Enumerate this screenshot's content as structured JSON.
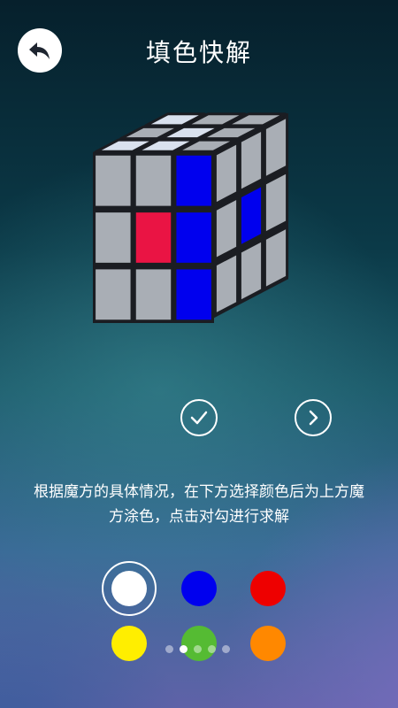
{
  "header": {
    "title": "填色快解",
    "back_icon": "back-arrow-icon"
  },
  "cube": {
    "top_face": [
      "#d9e1ee",
      "#a9aeb5",
      "#a9aeb5",
      "#a9aeb5",
      "#d9e1ee",
      "#a9aeb5",
      "#d9e1ee",
      "#d9e1ee",
      "#a9aeb5"
    ],
    "front_face": [
      "#a9aeb5",
      "#a9aeb5",
      "#0000ee",
      "#a9aeb5",
      "#ea1444",
      "#0000ee",
      "#a9aeb5",
      "#a9aeb5",
      "#0000ee"
    ],
    "right_face": [
      "#a9aeb5",
      "#a9aeb5",
      "#a9aeb5",
      "#a9aeb5",
      "#0000ee",
      "#a9aeb5",
      "#a9aeb5",
      "#a9aeb5",
      "#a9aeb5"
    ]
  },
  "actions": {
    "confirm_icon": "check-icon",
    "next_icon": "chevron-right-icon"
  },
  "instruction": "根据魔方的具体情况，在下方选择颜色后为上方魔方涂色，点击对勾进行求解",
  "palette": {
    "selected": "white",
    "colors": [
      {
        "name": "white",
        "hex": "#ffffff"
      },
      {
        "name": "blue",
        "hex": "#0000ee"
      },
      {
        "name": "red",
        "hex": "#ee0000"
      },
      {
        "name": "yellow",
        "hex": "#ffee00"
      },
      {
        "name": "green",
        "hex": "#55bb33"
      },
      {
        "name": "orange",
        "hex": "#ff8800"
      }
    ]
  },
  "pager": {
    "count": 5,
    "active_index": 1
  }
}
